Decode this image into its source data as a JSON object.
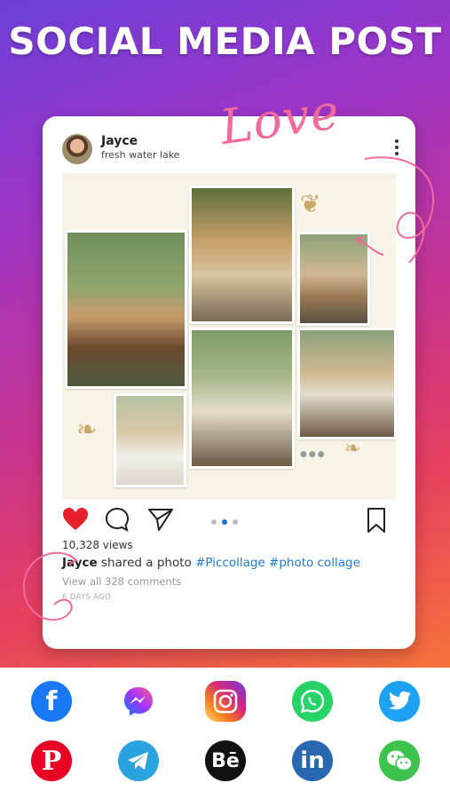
{
  "headline": "SOCIAL MEDIA POST",
  "post": {
    "username": "Jayce",
    "location": "fresh water lake",
    "decor_word": "Love",
    "views": "10,328 views",
    "caption_user": "Jayce",
    "caption_text": " shared a photo ",
    "hashtags": "#Piccollage #photo collage",
    "comments_link": "View all 328 comments",
    "time_ago": "6 DAYS AGO"
  },
  "social_icons": {
    "row1": [
      "facebook-icon",
      "messenger-icon",
      "instagram-icon",
      "whatsapp-icon",
      "twitter-icon"
    ],
    "row2": [
      "pinterest-icon",
      "telegram-icon",
      "behance-icon",
      "linkedin-icon",
      "wechat-icon"
    ],
    "behance_text": "Bē",
    "linkedin_text": "in"
  },
  "colors": {
    "accent_pink": "#f06a9b",
    "hashtag_blue": "#1e7ad2",
    "like_red": "#e8202a",
    "facebook": "#1877f2",
    "whatsapp": "#25d366",
    "twitter": "#1da1f2",
    "pinterest": "#e60023",
    "telegram": "#2aa3de",
    "behance": "#111111",
    "linkedin": "#2a67b1",
    "wechat": "#3dc24d"
  }
}
